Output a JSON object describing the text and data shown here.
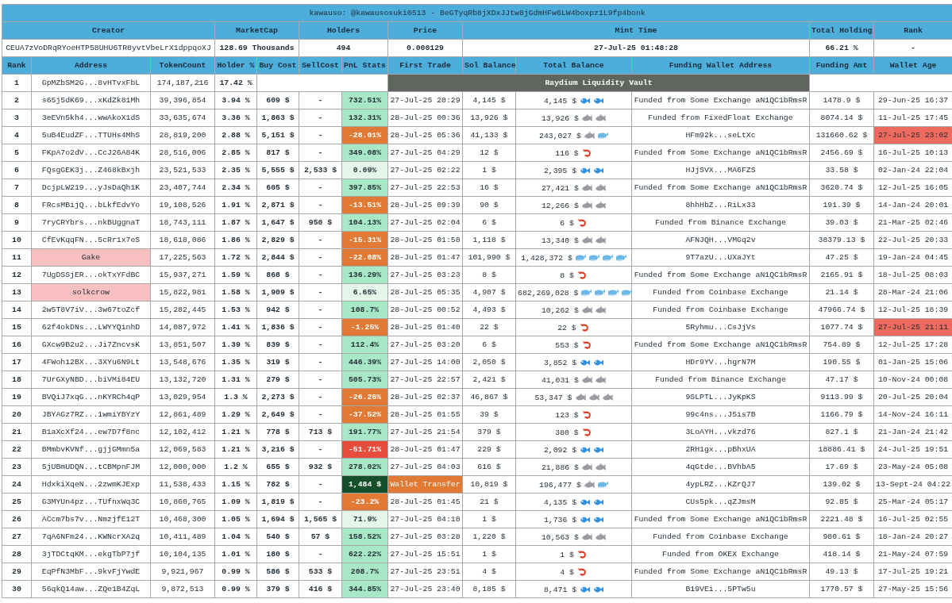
{
  "title": "kawauso: @kawausosuki0513 - BeGTyqRb8jXDxJJtw8jGdmHFw6LW4boxpz1L9fp4bonk",
  "summary": [
    {
      "label": "Creator",
      "value": "CEUA7zVoDRqRYoeHTP58UHU6TR8yvtVbeLrX1dppqoXJ"
    },
    {
      "label": "MarketCap",
      "value": "128.69 Thousands"
    },
    {
      "label": "Holders",
      "value": "494"
    },
    {
      "label": "Price",
      "value": "0.000129"
    },
    {
      "label": "Mint Time",
      "value": "27-Jul-25 01:48:28"
    },
    {
      "label": "Total Holding",
      "value": "66.21 %"
    },
    {
      "label": "Rank",
      "value": "-"
    }
  ],
  "columns": [
    "Rank",
    "Address",
    "TokenCount",
    "Holder %",
    "Buy Cost",
    "SellCost",
    "PnL Stats",
    "First Trade",
    "Sol Balance",
    "Total Balance",
    "Funding Wallet Address",
    "Funding Amt",
    "Wallet Age"
  ],
  "rows": [
    {
      "kind": "vault",
      "rank": "1",
      "address": {
        "text": "GpMZbSM2G...8vHTvxFbL"
      },
      "tokens": "174,187,216",
      "holder_pct": "17.42 %",
      "vault_label": "Raydium Liquidity Vault"
    },
    {
      "kind": "holder",
      "rank": "2",
      "address": {
        "text": "s65j5dK69...xKdZk81Mh"
      },
      "tokens": "39,396,854",
      "holder_pct": "3.94 %",
      "buy_cost": "609 $",
      "sell_cost": "-",
      "pnl": {
        "text": "732.51%",
        "color": "#a9e8c6"
      },
      "first_trade": {
        "text": "27-Jul-25 20:29"
      },
      "sol_balance": "4,145 $",
      "total_balance": "4,145 $",
      "balance_icons": [
        {
          "kind": "fish"
        },
        {
          "kind": "fish"
        }
      ],
      "funding_source": "Funded from Some Exchange aN1QC1bRmsR",
      "funding_amt": "1478.9 $",
      "wallet_age": {
        "text": "29-Jun-25 16:37"
      }
    },
    {
      "kind": "holder",
      "rank": "3",
      "address": {
        "text": "3eEVn5kh4...wwAkoX1dS"
      },
      "tokens": "33,635,674",
      "holder_pct": "3.36 %",
      "buy_cost": "1,863 $",
      "sell_cost": "-",
      "pnl": {
        "text": "132.31%",
        "color": "#a9e8c6"
      },
      "first_trade": {
        "text": "28-Jul-25 00:36"
      },
      "sol_balance": "13,926 $",
      "total_balance": "13,926 $",
      "balance_icons": [
        {
          "kind": "shark"
        },
        {
          "kind": "shark"
        }
      ],
      "funding_source": "Funded from FixedFloat Exchange",
      "funding_amt": "8074.14 $",
      "wallet_age": {
        "text": "11-Jul-25 17:45"
      }
    },
    {
      "kind": "holder",
      "rank": "4",
      "address": {
        "text": "5uB4EudZF...TTUHs4MhS"
      },
      "tokens": "28,819,200",
      "holder_pct": "2.88 %",
      "buy_cost": "5,151 $",
      "sell_cost": "-",
      "pnl": {
        "text": "-28.01%",
        "color": "#e07a35"
      },
      "first_trade": {
        "text": "28-Jul-25 05:36"
      },
      "sol_balance": "41,133 $",
      "total_balance": "243,027 $",
      "balance_icons": [
        {
          "kind": "shark"
        },
        {
          "kind": "whale"
        }
      ],
      "funding_source": "HFm92k...seLtXc",
      "funding_amt": "131660.62 $",
      "wallet_age": {
        "text": "27-Jul-25 23:02",
        "color": "#ec6b5e"
      }
    },
    {
      "kind": "holder",
      "rank": "5",
      "address": {
        "text": "FKpA7o2dV...CcJ26A84K"
      },
      "tokens": "28,516,006",
      "holder_pct": "2.85 %",
      "buy_cost": "817 $",
      "sell_cost": "-",
      "pnl": {
        "text": "349.08%",
        "color": "#a9e8c6"
      },
      "first_trade": {
        "text": "27-Jul-25 04:29"
      },
      "sol_balance": "12 $",
      "total_balance": "116 $",
      "balance_icons": [
        {
          "kind": "shrimp"
        }
      ],
      "funding_source": "Funded from Some Exchange aN1QC1bRmsR",
      "funding_amt": "2456.69 $",
      "wallet_age": {
        "text": "16-Jul-25 10:13"
      }
    },
    {
      "kind": "holder",
      "rank": "6",
      "address": {
        "text": "FQsgGEK3j...Z468kBxjh"
      },
      "tokens": "23,521,533",
      "holder_pct": "2.35 %",
      "buy_cost": "5,555 $",
      "sell_cost": "2,533 $",
      "pnl": {
        "text": "0.09%",
        "color": "#e6f6ea"
      },
      "first_trade": {
        "text": "27-Jul-25 02:22"
      },
      "sol_balance": "1 $",
      "total_balance": "2,395 $",
      "balance_icons": [
        {
          "kind": "fish"
        },
        {
          "kind": "fish"
        }
      ],
      "funding_source": "HJjSVX...MA6FZS",
      "funding_amt": "33.58 $",
      "wallet_age": {
        "text": "02-Jan-24 22:04"
      }
    },
    {
      "kind": "holder",
      "rank": "7",
      "address": {
        "text": "DcjpLW219...yJsDaQh1K"
      },
      "tokens": "23,407,744",
      "holder_pct": "2.34 %",
      "buy_cost": "605 $",
      "sell_cost": "-",
      "pnl": {
        "text": "397.85%",
        "color": "#a9e8c6"
      },
      "first_trade": {
        "text": "27-Jul-25 22:53"
      },
      "sol_balance": "16 $",
      "total_balance": "27,421 $",
      "balance_icons": [
        {
          "kind": "shark"
        },
        {
          "kind": "shark"
        }
      ],
      "funding_source": "Funded from Some Exchange aN1QC1bRmsR",
      "funding_amt": "3620.74 $",
      "wallet_age": {
        "text": "12-Jul-25 16:05"
      }
    },
    {
      "kind": "holder",
      "rank": "8",
      "address": {
        "text": "FRcsMBijQ...bLkfEdvYo"
      },
      "tokens": "19,108,526",
      "holder_pct": "1.91 %",
      "buy_cost": "2,871 $",
      "sell_cost": "-",
      "pnl": {
        "text": "-13.51%",
        "color": "#e07a35"
      },
      "first_trade": {
        "text": "28-Jul-25 09:39"
      },
      "sol_balance": "90 $",
      "total_balance": "12,266 $",
      "balance_icons": [
        {
          "kind": "shark"
        },
        {
          "kind": "shark"
        }
      ],
      "funding_source": "8hhHbZ...RiLx33",
      "funding_amt": "191.39 $",
      "wallet_age": {
        "text": "14-Jan-24 20:01"
      }
    },
    {
      "kind": "holder",
      "rank": "9",
      "address": {
        "text": "7ryCRYbrs...nkBUggnaT"
      },
      "tokens": "18,743,111",
      "holder_pct": "1.87 %",
      "buy_cost": "1,647 $",
      "sell_cost": "950 $",
      "pnl": {
        "text": "104.13%",
        "color": "#a9e8c6"
      },
      "first_trade": {
        "text": "27-Jul-25 02:04"
      },
      "sol_balance": "6 $",
      "total_balance": "6 $",
      "balance_icons": [
        {
          "kind": "shrimp"
        }
      ],
      "funding_source": "Funded from Binance Exchange",
      "funding_amt": "39.03 $",
      "wallet_age": {
        "text": "21-Mar-25 02:46"
      }
    },
    {
      "kind": "holder",
      "rank": "10",
      "address": {
        "text": "CfEvKqqFN...5cRr1x7eS"
      },
      "tokens": "18,618,086",
      "holder_pct": "1.86 %",
      "buy_cost": "2,829 $",
      "sell_cost": "-",
      "pnl": {
        "text": "-15.31%",
        "color": "#e07a35"
      },
      "first_trade": {
        "text": "28-Jul-25 01:58"
      },
      "sol_balance": "1,118 $",
      "total_balance": "13,340 $",
      "balance_icons": [
        {
          "kind": "shark"
        },
        {
          "kind": "shark"
        }
      ],
      "funding_source": "AFNJQH...VMGq2v",
      "funding_amt": "38379.13 $",
      "wallet_age": {
        "text": "22-Jul-25 20:33"
      }
    },
    {
      "kind": "holder",
      "rank": "11",
      "address": {
        "text": "Gake",
        "color": "#f8c0c0"
      },
      "tokens": "17,225,563",
      "holder_pct": "1.72 %",
      "buy_cost": "2,844 $",
      "sell_cost": "-",
      "pnl": {
        "text": "-22.08%",
        "color": "#e07a35"
      },
      "first_trade": {
        "text": "28-Jul-25 01:47"
      },
      "sol_balance": "101,990 $",
      "total_balance": "1,428,372 $",
      "balance_icons": [
        {
          "kind": "whale"
        },
        {
          "kind": "whale"
        },
        {
          "kind": "whale"
        },
        {
          "kind": "whale"
        }
      ],
      "funding_source": "9T7azU...UXaJYt",
      "funding_amt": "47.25 $",
      "wallet_age": {
        "text": "19-Jan-24 04:45"
      }
    },
    {
      "kind": "holder",
      "rank": "12",
      "address": {
        "text": "7UgDSSjER...okTxYFdBC"
      },
      "tokens": "15,937,271",
      "holder_pct": "1.59 %",
      "buy_cost": "868 $",
      "sell_cost": "-",
      "pnl": {
        "text": "136.29%",
        "color": "#a9e8c6"
      },
      "first_trade": {
        "text": "27-Jul-25 03:23"
      },
      "sol_balance": "8 $",
      "total_balance": "8 $",
      "balance_icons": [
        {
          "kind": "shrimp"
        }
      ],
      "funding_source": "Funded from Some Exchange aN1QC1bRmsR",
      "funding_amt": "2165.91 $",
      "wallet_age": {
        "text": "18-Jul-25 08:03"
      }
    },
    {
      "kind": "holder",
      "rank": "13",
      "address": {
        "text": "solkcrow",
        "color": "#f8c0c0"
      },
      "tokens": "15,822,981",
      "holder_pct": "1.58 %",
      "buy_cost": "1,909 $",
      "sell_cost": "-",
      "pnl": {
        "text": "6.65%",
        "color": "#e6f6ea"
      },
      "first_trade": {
        "text": "28-Jul-25 05:35"
      },
      "sol_balance": "4,907 $",
      "total_balance": "682,269,028 $",
      "balance_icons": [
        {
          "kind": "whale"
        },
        {
          "kind": "whale"
        },
        {
          "kind": "whale"
        },
        {
          "kind": "whale"
        }
      ],
      "funding_source": "Funded from Coinbase Exchange",
      "funding_amt": "21.14 $",
      "wallet_age": {
        "text": "28-Mar-24 21:06"
      }
    },
    {
      "kind": "holder",
      "rank": "14",
      "address": {
        "text": "2w5T8V7iV...3w67toZcf"
      },
      "tokens": "15,282,445",
      "holder_pct": "1.53 %",
      "buy_cost": "942 $",
      "sell_cost": "-",
      "pnl": {
        "text": "108.7%",
        "color": "#a9e8c6"
      },
      "first_trade": {
        "text": "28-Jul-25 00:52"
      },
      "sol_balance": "4,493 $",
      "total_balance": "10,262 $",
      "balance_icons": [
        {
          "kind": "shark"
        },
        {
          "kind": "shark"
        }
      ],
      "funding_source": "Funded from Coinbase Exchange",
      "funding_amt": "47966.74 $",
      "wallet_age": {
        "text": "12-Jul-25 18:39"
      }
    },
    {
      "kind": "holder",
      "rank": "15",
      "address": {
        "text": "62f4okDNs...LWYYQinhD"
      },
      "tokens": "14,087,972",
      "holder_pct": "1.41 %",
      "buy_cost": "1,836 $",
      "sell_cost": "-",
      "pnl": {
        "text": "-1.25%",
        "color": "#e07a35"
      },
      "first_trade": {
        "text": "28-Jul-25 01:40"
      },
      "sol_balance": "22 $",
      "total_balance": "22 $",
      "balance_icons": [
        {
          "kind": "shrimp"
        }
      ],
      "funding_source": "5Ryhmu...CsJjVs",
      "funding_amt": "1077.74 $",
      "wallet_age": {
        "text": "27-Jul-25 21:11",
        "color": "#ec6b5e"
      }
    },
    {
      "kind": "holder",
      "rank": "16",
      "address": {
        "text": "GXcw9B2u2...Ji7ZncvsK"
      },
      "tokens": "13,851,507",
      "holder_pct": "1.39 %",
      "buy_cost": "839 $",
      "sell_cost": "-",
      "pnl": {
        "text": "112.4%",
        "color": "#a9e8c6"
      },
      "first_trade": {
        "text": "27-Jul-25 03:20"
      },
      "sol_balance": "6 $",
      "total_balance": "553 $",
      "balance_icons": [
        {
          "kind": "shrimp"
        }
      ],
      "funding_source": "Funded from Some Exchange aN1QC1bRmsR",
      "funding_amt": "754.89 $",
      "wallet_age": {
        "text": "12-Jul-25 17:28"
      }
    },
    {
      "kind": "holder",
      "rank": "17",
      "address": {
        "text": "4FWoh12BX...3XYu6N9Lt"
      },
      "tokens": "13,548,676",
      "holder_pct": "1.35 %",
      "buy_cost": "319 $",
      "sell_cost": "-",
      "pnl": {
        "text": "446.39%",
        "color": "#a9e8c6"
      },
      "first_trade": {
        "text": "27-Jul-25 14:00"
      },
      "sol_balance": "2,050 $",
      "total_balance": "3,852 $",
      "balance_icons": [
        {
          "kind": "fish"
        },
        {
          "kind": "fish"
        }
      ],
      "funding_source": "HDr9YV...hgrN7M",
      "funding_amt": "190.55 $",
      "wallet_age": {
        "text": "01-Jan-25 15:06"
      }
    },
    {
      "kind": "holder",
      "rank": "18",
      "address": {
        "text": "7UrGXyNBD...biVMi84EU"
      },
      "tokens": "13,132,720",
      "holder_pct": "1.31 %",
      "buy_cost": "279 $",
      "sell_cost": "-",
      "pnl": {
        "text": "505.73%",
        "color": "#a9e8c6"
      },
      "first_trade": {
        "text": "27-Jul-25 22:57"
      },
      "sol_balance": "2,421 $",
      "total_balance": "41,031 $",
      "balance_icons": [
        {
          "kind": "shark"
        },
        {
          "kind": "shark"
        }
      ],
      "funding_source": "Funded from Binance Exchange",
      "funding_amt": "47.17 $",
      "wallet_age": {
        "text": "10-Nov-24 00:08"
      }
    },
    {
      "kind": "holder",
      "rank": "19",
      "address": {
        "text": "BVQiJ7xqG...nKYRCh4qP"
      },
      "tokens": "13,029,954",
      "holder_pct": "1.3 %",
      "buy_cost": "2,273 $",
      "sell_cost": "-",
      "pnl": {
        "text": "-26.26%",
        "color": "#e07a35"
      },
      "first_trade": {
        "text": "28-Jul-25 02:37"
      },
      "sol_balance": "46,867 $",
      "total_balance": "53,347 $",
      "balance_icons": [
        {
          "kind": "shark"
        },
        {
          "kind": "shark"
        },
        {
          "kind": "shark"
        }
      ],
      "funding_source": "9SLPTL...JyKpKS",
      "funding_amt": "9113.99 $",
      "wallet_age": {
        "text": "20-Jul-25 20:04"
      }
    },
    {
      "kind": "holder",
      "rank": "20",
      "address": {
        "text": "JBYAGz7RZ...1wmiYBYzY"
      },
      "tokens": "12,861,489",
      "holder_pct": "1.29 %",
      "buy_cost": "2,649 $",
      "sell_cost": "-",
      "pnl": {
        "text": "-37.52%",
        "color": "#e07a35"
      },
      "first_trade": {
        "text": "28-Jul-25 01:55"
      },
      "sol_balance": "39 $",
      "total_balance": "123 $",
      "balance_icons": [
        {
          "kind": "shrimp"
        }
      ],
      "funding_source": "99c4ns...J5is7B",
      "funding_amt": "1166.79 $",
      "wallet_age": {
        "text": "14-Nov-24 16:11"
      }
    },
    {
      "kind": "holder",
      "rank": "21",
      "address": {
        "text": "B1aXcXf24...ew7D7f8nc"
      },
      "tokens": "12,102,412",
      "holder_pct": "1.21 %",
      "buy_cost": "778 $",
      "sell_cost": "713 $",
      "pnl": {
        "text": "191.77%",
        "color": "#a9e8c6"
      },
      "first_trade": {
        "text": "27-Jul-25 21:54"
      },
      "sol_balance": "379 $",
      "total_balance": "380 $",
      "balance_icons": [
        {
          "kind": "shrimp"
        }
      ],
      "funding_source": "3LoAYH...vkzd76",
      "funding_amt": "827.1 $",
      "wallet_age": {
        "text": "21-Jan-24 21:42"
      }
    },
    {
      "kind": "holder",
      "rank": "22",
      "address": {
        "text": "BMmbvKVNf...gjjGMmn5a"
      },
      "tokens": "12,069,583",
      "holder_pct": "1.21 %",
      "buy_cost": "3,216 $",
      "sell_cost": "-",
      "pnl": {
        "text": "-51.71%",
        "color": "#e84c3d"
      },
      "first_trade": {
        "text": "28-Jul-25 01:47"
      },
      "sol_balance": "229 $",
      "total_balance": "2,092 $",
      "balance_icons": [
        {
          "kind": "fish"
        },
        {
          "kind": "fish"
        }
      ],
      "funding_source": "2RH1gx...pBhxUA",
      "funding_amt": "18886.41 $",
      "wallet_age": {
        "text": "24-Jul-25 19:51"
      }
    },
    {
      "kind": "holder",
      "rank": "23",
      "address": {
        "text": "5jUBmUDQN...tCBMpnFJM"
      },
      "tokens": "12,000,000",
      "holder_pct": "1.2 %",
      "buy_cost": "655 $",
      "sell_cost": "932 $",
      "pnl": {
        "text": "278.02%",
        "color": "#a9e8c6"
      },
      "first_trade": {
        "text": "27-Jul-25 04:03"
      },
      "sol_balance": "616 $",
      "total_balance": "21,886 $",
      "balance_icons": [
        {
          "kind": "shark"
        },
        {
          "kind": "shark"
        }
      ],
      "funding_source": "4qGtde...BVhbA5",
      "funding_amt": "17.69 $",
      "wallet_age": {
        "text": "23-May-24 05:08"
      }
    },
    {
      "kind": "holder",
      "rank": "24",
      "address": {
        "text": "HdxkiXqeN...2zwmKJExp"
      },
      "tokens": "11,538,433",
      "holder_pct": "1.15 %",
      "buy_cost": "782 $",
      "sell_cost": "-",
      "pnl": {
        "text": "1,484 $",
        "color": "#16502a"
      },
      "first_trade": {
        "text": "Wallet Transfer",
        "color": "#e07a35"
      },
      "sol_balance": "10,819 $",
      "total_balance": "196,477 $",
      "balance_icons": [
        {
          "kind": "shark"
        },
        {
          "kind": "whale"
        }
      ],
      "funding_source": "4ypLRZ...KZrQJ7",
      "funding_amt": "139.02 $",
      "wallet_age": {
        "text": "13-Sept-24 04:22"
      }
    },
    {
      "kind": "holder",
      "rank": "25",
      "address": {
        "text": "G3MYUn4pz...TUfnxWq3C"
      },
      "tokens": "10,860,765",
      "holder_pct": "1.09 %",
      "buy_cost": "1,819 $",
      "sell_cost": "-",
      "pnl": {
        "text": "-23.2%",
        "color": "#e07a35"
      },
      "first_trade": {
        "text": "28-Jul-25 01:45"
      },
      "sol_balance": "21 $",
      "total_balance": "4,135 $",
      "balance_icons": [
        {
          "kind": "fish"
        },
        {
          "kind": "fish"
        }
      ],
      "funding_source": "CUs5pk...qZJmsM",
      "funding_amt": "92.85 $",
      "wallet_age": {
        "text": "25-Mar-24 05:17"
      }
    },
    {
      "kind": "holder",
      "rank": "26",
      "address": {
        "text": "ACcm7bs7v...NmzjfE12T"
      },
      "tokens": "10,468,300",
      "holder_pct": "1.05 %",
      "buy_cost": "1,694 $",
      "sell_cost": "1,565 $",
      "pnl": {
        "text": "71.9%",
        "color": "#e6f6ea"
      },
      "first_trade": {
        "text": "27-Jul-25 04:18"
      },
      "sol_balance": "1 $",
      "total_balance": "1,736 $",
      "balance_icons": [
        {
          "kind": "fish"
        },
        {
          "kind": "fish"
        }
      ],
      "funding_source": "Funded from Some Exchange aN1QC1bRmsR",
      "funding_amt": "2221.48 $",
      "wallet_age": {
        "text": "16-Jul-25 02:55"
      }
    },
    {
      "kind": "holder",
      "rank": "27",
      "address": {
        "text": "7qA6NFm24...KWNcrXA2q"
      },
      "tokens": "10,411,489",
      "holder_pct": "1.04 %",
      "buy_cost": "540 $",
      "sell_cost": "57 $",
      "pnl": {
        "text": "158.52%",
        "color": "#a9e8c6"
      },
      "first_trade": {
        "text": "27-Jul-25 03:28"
      },
      "sol_balance": "1,220 $",
      "total_balance": "10,563 $",
      "balance_icons": [
        {
          "kind": "shark"
        },
        {
          "kind": "shark"
        }
      ],
      "funding_source": "Funded from Coinbase Exchange",
      "funding_amt": "980.61 $",
      "wallet_age": {
        "text": "18-Jan-24 20:27"
      }
    },
    {
      "kind": "holder",
      "rank": "28",
      "address": {
        "text": "3jTDCtqKM...ekgTbP7jf"
      },
      "tokens": "10,104,135",
      "holder_pct": "1.01 %",
      "buy_cost": "180 $",
      "sell_cost": "-",
      "pnl": {
        "text": "622.22%",
        "color": "#a9e8c6"
      },
      "first_trade": {
        "text": "27-Jul-25 15:51"
      },
      "sol_balance": "1 $",
      "total_balance": "1 $",
      "balance_icons": [
        {
          "kind": "shrimp"
        }
      ],
      "funding_source": "Funded from OKEX Exchange",
      "funding_amt": "418.14 $",
      "wallet_age": {
        "text": "21-May-24 07:59"
      }
    },
    {
      "kind": "holder",
      "rank": "29",
      "address": {
        "text": "EqPfN3MbF...9kvFjYwdE"
      },
      "tokens": "9,921,967",
      "holder_pct": "0.99 %",
      "buy_cost": "586 $",
      "sell_cost": "533 $",
      "pnl": {
        "text": "208.7%",
        "color": "#a9e8c6"
      },
      "first_trade": {
        "text": "27-Jul-25 23:51"
      },
      "sol_balance": "4 $",
      "total_balance": "4 $",
      "balance_icons": [
        {
          "kind": "shrimp"
        }
      ],
      "funding_source": "Funded from Some Exchange aN1QC1bRmsR",
      "funding_amt": "49.13 $",
      "wallet_age": {
        "text": "17-Jul-25 19:21"
      }
    },
    {
      "kind": "holder",
      "rank": "30",
      "address": {
        "text": "56qkQ14aw...ZQe1B4ZqL"
      },
      "tokens": "9,872,513",
      "holder_pct": "0.99 %",
      "buy_cost": "379 $",
      "sell_cost": "416 $",
      "pnl": {
        "text": "344.85%",
        "color": "#a9e8c6"
      },
      "first_trade": {
        "text": "27-Jul-25 23:40"
      },
      "sol_balance": "8,185 $",
      "total_balance": "8,471 $",
      "balance_icons": [
        {
          "kind": "fish"
        },
        {
          "kind": "fish"
        }
      ],
      "funding_source": "B19VEi...5PTw5u",
      "funding_amt": "1770.57 $",
      "wallet_age": {
        "text": "27-May-25 15:56"
      }
    }
  ]
}
